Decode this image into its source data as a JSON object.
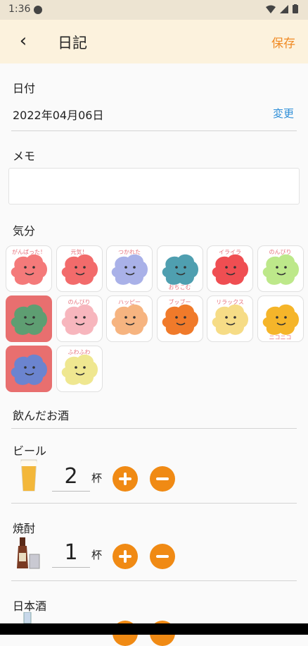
{
  "status": {
    "time": "1:36"
  },
  "header": {
    "title": "日記",
    "save_label": "保存",
    "back_icon": "back-arrow-icon"
  },
  "date_section": {
    "label": "日付",
    "value": "2022年04月06日",
    "change_label": "変更"
  },
  "memo_section": {
    "label": "メモ",
    "value": "",
    "placeholder": ""
  },
  "mood_section": {
    "label": "気分",
    "moods": [
      {
        "caption": "がんばった！",
        "color": "#f47a7a",
        "selected": false
      },
      {
        "caption": "元気！",
        "color": "#f26b6b",
        "selected": false
      },
      {
        "caption": "つかれた",
        "color": "#a9b1e8",
        "selected": false
      },
      {
        "caption": "おちこむ",
        "color": "#4f9fb0",
        "selected": false
      },
      {
        "caption": "イライラ",
        "color": "#ef4e52",
        "selected": false
      },
      {
        "caption": "のんびり",
        "color": "#bde88a",
        "selected": false
      },
      {
        "caption": "",
        "color": "#5e9e72",
        "selected": true
      },
      {
        "caption": "のんびり",
        "color": "#f7b6bd",
        "selected": false
      },
      {
        "caption": "ハッピー",
        "color": "#f6b480",
        "selected": false
      },
      {
        "caption": "ブッブー",
        "color": "#f07a2a",
        "selected": false
      },
      {
        "caption": "リラックス",
        "color": "#f6dc86",
        "selected": false
      },
      {
        "caption": "ニコニコ",
        "color": "#f5b52a",
        "selected": false
      },
      {
        "caption": "",
        "color": "#6b84cf",
        "selected": true
      },
      {
        "caption": "ふわふわ",
        "color": "#efe790",
        "selected": false
      }
    ]
  },
  "drinks_section": {
    "label": "飲んだお酒",
    "unit": "杯",
    "items": [
      {
        "name": "ビール",
        "count": "2"
      },
      {
        "name": "焼酎",
        "count": "1"
      },
      {
        "name": "日本酒",
        "count": ""
      }
    ]
  },
  "colors": {
    "accent": "#f08a14",
    "link": "#2f8fd8",
    "appbar": "#fcf2dd",
    "selected_mood": "#e86f6f"
  }
}
